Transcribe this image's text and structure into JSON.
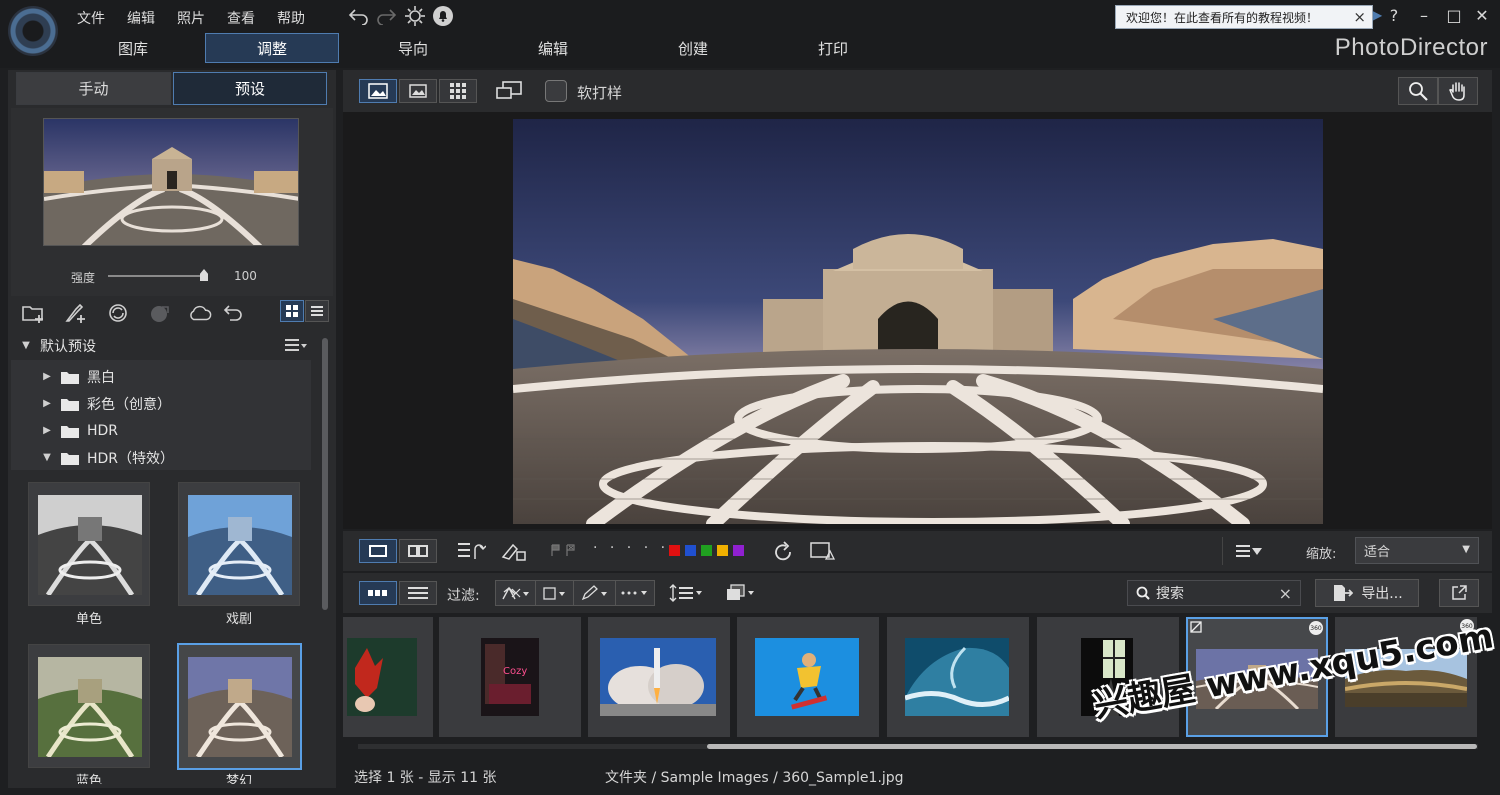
{
  "menu": {
    "items": [
      "文件",
      "编辑",
      "照片",
      "查看",
      "帮助"
    ]
  },
  "main_tabs": [
    "图库",
    "调整",
    "导向",
    "编辑",
    "创建",
    "打印"
  ],
  "active_tab": "调整",
  "brand": "PhotoDirector",
  "welcome": {
    "text": "欢迎您！在此查看所有的教程视频！",
    "close": "×"
  },
  "window": {
    "help": "?",
    "minimize": "–",
    "maximize": "□",
    "close": "✕"
  },
  "left": {
    "tabs": [
      "手动",
      "预设"
    ],
    "active": "预设",
    "strength_label": "强度",
    "strength_value": "100",
    "strength_fraction": 1.0,
    "tree_header": "默认预设",
    "tree": [
      {
        "label": "黑白",
        "expanded": false
      },
      {
        "label": "彩色（创意）",
        "expanded": false
      },
      {
        "label": "HDR",
        "expanded": false
      },
      {
        "label": "HDR（特效）",
        "expanded": true
      }
    ],
    "presets": [
      "单色",
      "戏剧",
      "蓝色",
      "梦幻"
    ]
  },
  "toolbar1": {
    "softproof_label": "软打样"
  },
  "toolbar2": {
    "zoom_label": "缩放:",
    "zoom_value": "适合",
    "rating_dots": "· · · · ·",
    "color_labels": [
      "#e01010",
      "#2050d0",
      "#20a020",
      "#f0b000",
      "#9020d0"
    ]
  },
  "toolbar3": {
    "filter_label": "过滤:",
    "search_placeholder": "搜索",
    "export_label": "导出..."
  },
  "filmstrip": {
    "selected_index": 6,
    "count": 8
  },
  "status": {
    "selection": "选择 1 张 - 显示 11 张",
    "path": "文件夹 / Sample Images / 360_Sample1.jpg"
  },
  "watermark": "兴趣屋 www.xqu5.com",
  "colors": {
    "accent": "#4f7cb0",
    "select": "#5aa0e6",
    "panel": "#2a2b2d"
  }
}
